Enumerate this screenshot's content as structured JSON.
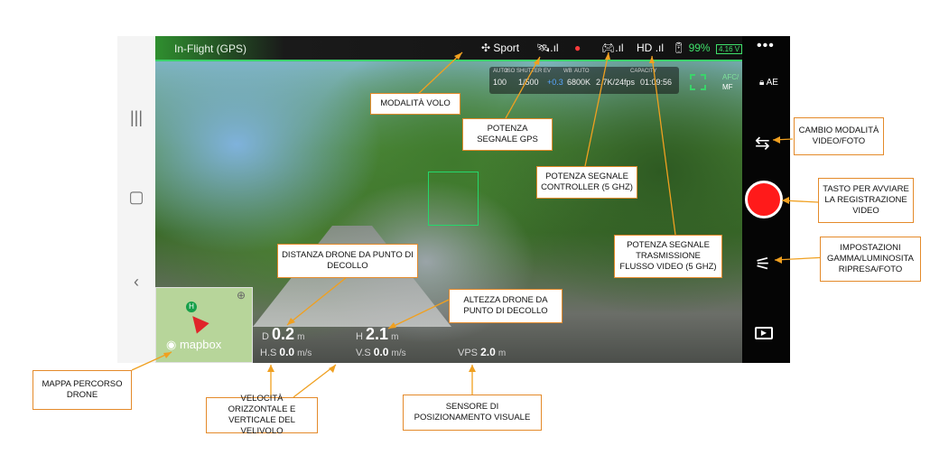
{
  "app": {
    "flight_mode_label": "In-Flight (GPS)",
    "nav_icons": [
      "recent-apps",
      "home",
      "back"
    ]
  },
  "top_bar": {
    "sport_mode": "Sport",
    "hd_label": "HD",
    "battery_percent": "99%",
    "battery_voltage": "4.16 V",
    "more": "•••"
  },
  "camera_params": {
    "headers": [
      "AUTO",
      "ISO",
      "SHUTTER",
      "EV",
      "WB",
      "AUTO",
      "CAPACITY"
    ],
    "iso": "100",
    "shutter": "1/500",
    "ev": "+0.3",
    "wb": "6800K",
    "resolution": "2.7K/24fps",
    "capacity": "01:09:56"
  },
  "focus": {
    "afc": "AFC/",
    "mf": "MF",
    "ae": "AE"
  },
  "map": {
    "home_label": "H",
    "brand": "mapbox"
  },
  "telemetry": {
    "distance_prefix": "D",
    "distance_value": "0.2",
    "distance_unit": "m",
    "altitude_prefix": "H",
    "altitude_value": "2.1",
    "altitude_unit": "m",
    "hs_label": "H.S",
    "hs_value": "0.0",
    "hs_unit": "m/s",
    "vs_label": "V.S",
    "vs_value": "0.0",
    "vs_unit": "m/s",
    "vps_label": "VPS",
    "vps_value": "2.0",
    "vps_unit": "m"
  },
  "callouts": {
    "modalita_volo": "MODALITÀ VOLO",
    "potenza_gps": "POTENZA SEGNALE GPS",
    "potenza_controller": "POTENZA SEGNALE CONTROLLER (5 GHZ)",
    "potenza_video": "POTENZA SEGNALE TRASMISSIONE FLUSSO VIDEO (5 GHZ)",
    "distanza_drone": "DISTANZA DRONE DA PUNTO DI DECOLLO",
    "altezza_drone": "ALTEZZA DRONE DA PUNTO DI DECOLLO",
    "cambio_modalita": "CAMBIO MODALITÀ VIDEO/FOTO",
    "tasto_registrazione": "TASTO PER AVVIARE LA REGISTRAZIONE VIDEO",
    "impostazioni": "IMPOSTAZIONI GAMMA/LUMINOSITA RIPRESA/FOTO",
    "mappa_percorso": "MAPPA PERCORSO DRONE",
    "velocita": "VELOCITÀ ORIZZONTALE E VERTICALE DEL VELIVOLO",
    "sensore": "SENSORE DI POSIZIONAMENTO VISUALE"
  },
  "colors": {
    "accent_green": "#3bd36b",
    "record_red": "#ff1a1a",
    "callout_border": "#e48a2a"
  }
}
